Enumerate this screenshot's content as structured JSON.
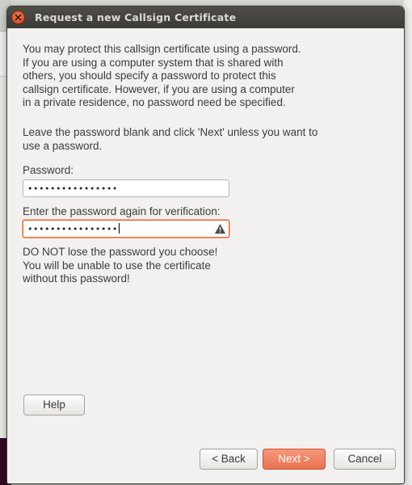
{
  "window": {
    "title": "Request a new Callsign Certificate"
  },
  "content": {
    "intro": "You may protect this callsign certificate using a password.\nIf you are using a computer system that is shared with\nothers, you should specify a password to protect this\ncallsign certificate. However, if you are using a computer\nin a private residence, no password need be specified.",
    "instruction": "Leave the password blank and click 'Next' unless you want to\nuse a password.",
    "password_label": "Password:",
    "password_value": "••••••••••••••••",
    "verify_label": "Enter the password again for verification:",
    "verify_value": "••••••••••••••••",
    "warning": "DO NOT lose the password you choose!\nYou will be unable to use the certificate\nwithout this password!"
  },
  "buttons": {
    "help": "Help",
    "back": "< Back",
    "next": "Next >",
    "cancel": "Cancel"
  },
  "icons": {
    "close": "close-icon",
    "mismatch_warning": "warning-icon"
  },
  "colors": {
    "titlebar": "#3c3b37",
    "accent": "#ea7452",
    "dialog_bg": "#f2f1f0"
  }
}
